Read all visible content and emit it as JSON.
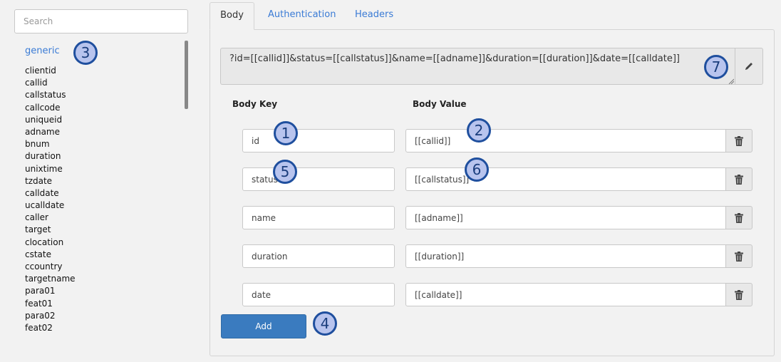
{
  "search": {
    "placeholder": "Search",
    "value": ""
  },
  "variables": {
    "group": "generic",
    "items": [
      "clientid",
      "callid",
      "callstatus",
      "callcode",
      "uniqueid",
      "adname",
      "bnum",
      "duration",
      "unixtime",
      "tzdate",
      "calldate",
      "ucalldate",
      "caller",
      "target",
      "clocation",
      "cstate",
      "ccountry",
      "targetname",
      "para01",
      "feat01",
      "para02",
      "feat02"
    ]
  },
  "tabs": [
    {
      "label": "Body",
      "active": true
    },
    {
      "label": "Authentication",
      "active": false
    },
    {
      "label": "Headers",
      "active": false
    }
  ],
  "query_string": "?id=[[callid]]&status=[[callstatus]]&name=[[adname]]&duration=[[duration]]&date=[[calldate]]",
  "columns": {
    "key": "Body Key",
    "value": "Body Value"
  },
  "rows": [
    {
      "key": "id",
      "value": "[[callid]]"
    },
    {
      "key": "status",
      "value": "[[callstatus]]"
    },
    {
      "key": "name",
      "value": "[[adname]]"
    },
    {
      "key": "duration",
      "value": "[[duration]]"
    },
    {
      "key": "date",
      "value": "[[calldate]]"
    }
  ],
  "add_label": "Add",
  "badges": [
    "1",
    "2",
    "3",
    "4",
    "5",
    "6",
    "7"
  ],
  "icons": {
    "edit": "pencil-icon",
    "delete": "trash-icon"
  },
  "colors": {
    "accent": "#3a7bd5",
    "button": "#3a7bbf",
    "badge_fill": "#b8c4ee",
    "badge_border": "#1f4f9e"
  }
}
